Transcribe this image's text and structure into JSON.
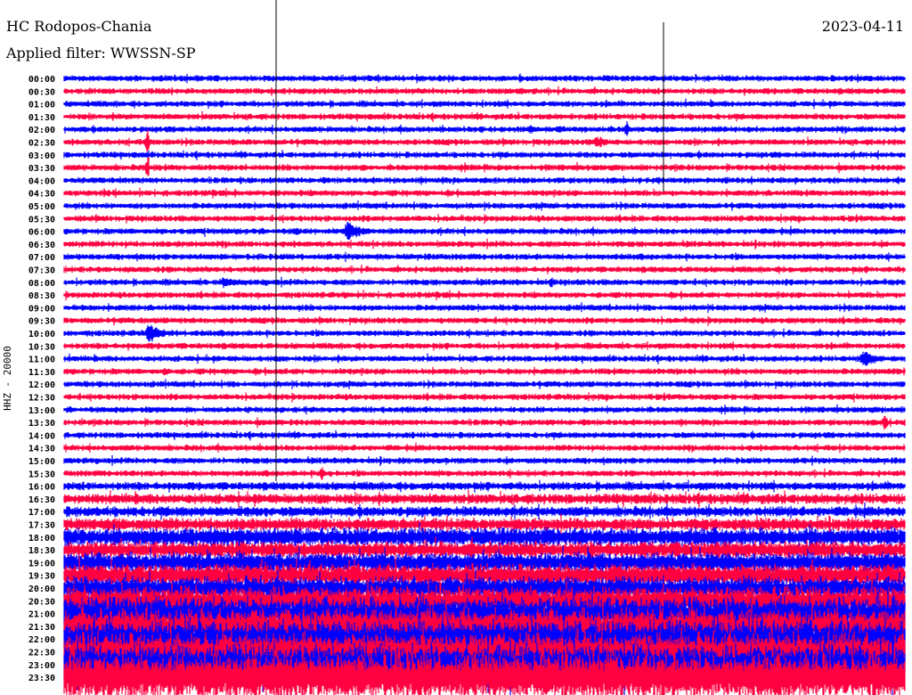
{
  "header": {
    "station": "HC Rodopos-Chania",
    "filter": "Applied filter: WWSSN-SP",
    "date": "2023-04-11",
    "channel": "HHZ - 20000"
  },
  "chart_data": {
    "type": "line",
    "title": "HC Rodopos-Chania",
    "subtitle": "Applied filter: WWSSN-SP",
    "ylabel": "HHZ - 20000",
    "minutes_per_row": 30,
    "colors": [
      "#0000ff",
      "#ff0040"
    ],
    "row_labels": [
      "00:00",
      "00:30",
      "01:00",
      "01:30",
      "02:00",
      "02:30",
      "03:00",
      "03:30",
      "04:00",
      "04:30",
      "05:00",
      "05:30",
      "06:00",
      "06:30",
      "07:00",
      "07:30",
      "08:00",
      "08:30",
      "09:00",
      "09:30",
      "10:00",
      "10:30",
      "11:00",
      "11:30",
      "12:00",
      "12:30",
      "13:00",
      "13:30",
      "14:00",
      "14:30",
      "15:00",
      "15:30",
      "16:00",
      "16:30",
      "17:00",
      "17:30",
      "18:00",
      "18:30",
      "19:00",
      "19:30",
      "20:00",
      "20:30",
      "21:00",
      "21:30",
      "22:00",
      "22:30",
      "23:00",
      "23:30"
    ],
    "noise_amplitude": [
      3,
      3,
      3,
      3,
      3,
      3,
      3,
      3,
      3,
      3,
      3,
      3,
      3,
      3,
      3,
      3,
      3,
      3,
      3,
      3,
      3,
      3,
      3,
      3,
      3,
      3,
      3,
      3,
      3,
      3,
      3,
      3,
      4,
      5,
      5,
      6,
      9,
      8,
      10,
      11,
      11,
      14,
      16,
      17,
      18,
      18,
      19,
      22
    ],
    "events": [
      {
        "row": 4,
        "minute": 14.9,
        "amp": 6,
        "dur": 0.3
      },
      {
        "row": 4,
        "minute": 16.6,
        "amp": 6,
        "dur": 1.2
      },
      {
        "row": 4,
        "minute": 17.7,
        "amp": 5,
        "dur": 1.0
      },
      {
        "row": 4,
        "minute": 20.1,
        "amp": 15,
        "dur": 0.1
      },
      {
        "row": 4,
        "minute": 24.4,
        "amp": 5,
        "dur": 0.1
      },
      {
        "row": 5,
        "minute": 19.0,
        "amp": 8,
        "dur": 1.0
      },
      {
        "row": 5,
        "minute": 3.0,
        "amp": 18,
        "dur": 0.1
      },
      {
        "row": 7,
        "minute": 10.7,
        "amp": 5,
        "dur": 0.5
      },
      {
        "row": 7,
        "minute": 3.0,
        "amp": 18,
        "dur": 0.1
      },
      {
        "row": 12,
        "minute": 8.3,
        "amp": 6,
        "dur": 0.4
      },
      {
        "row": 12,
        "minute": 10.1,
        "amp": 14,
        "dur": 1.2
      },
      {
        "row": 16,
        "minute": 5.7,
        "amp": 8,
        "dur": 1.3
      },
      {
        "row": 16,
        "minute": 17.4,
        "amp": 10,
        "dur": 0.1
      },
      {
        "row": 17,
        "minute": 10.0,
        "amp": 5,
        "dur": 0.4
      },
      {
        "row": 20,
        "minute": 3.0,
        "amp": 12,
        "dur": 1.3
      },
      {
        "row": 22,
        "minute": 28.5,
        "amp": 12,
        "dur": 1.2
      },
      {
        "row": 23,
        "minute": 3.6,
        "amp": 6,
        "dur": 0.4
      },
      {
        "row": 27,
        "minute": 29.3,
        "amp": 12,
        "dur": 0.2
      },
      {
        "row": 31,
        "minute": 9.2,
        "amp": 10,
        "dur": 0.2
      }
    ]
  }
}
